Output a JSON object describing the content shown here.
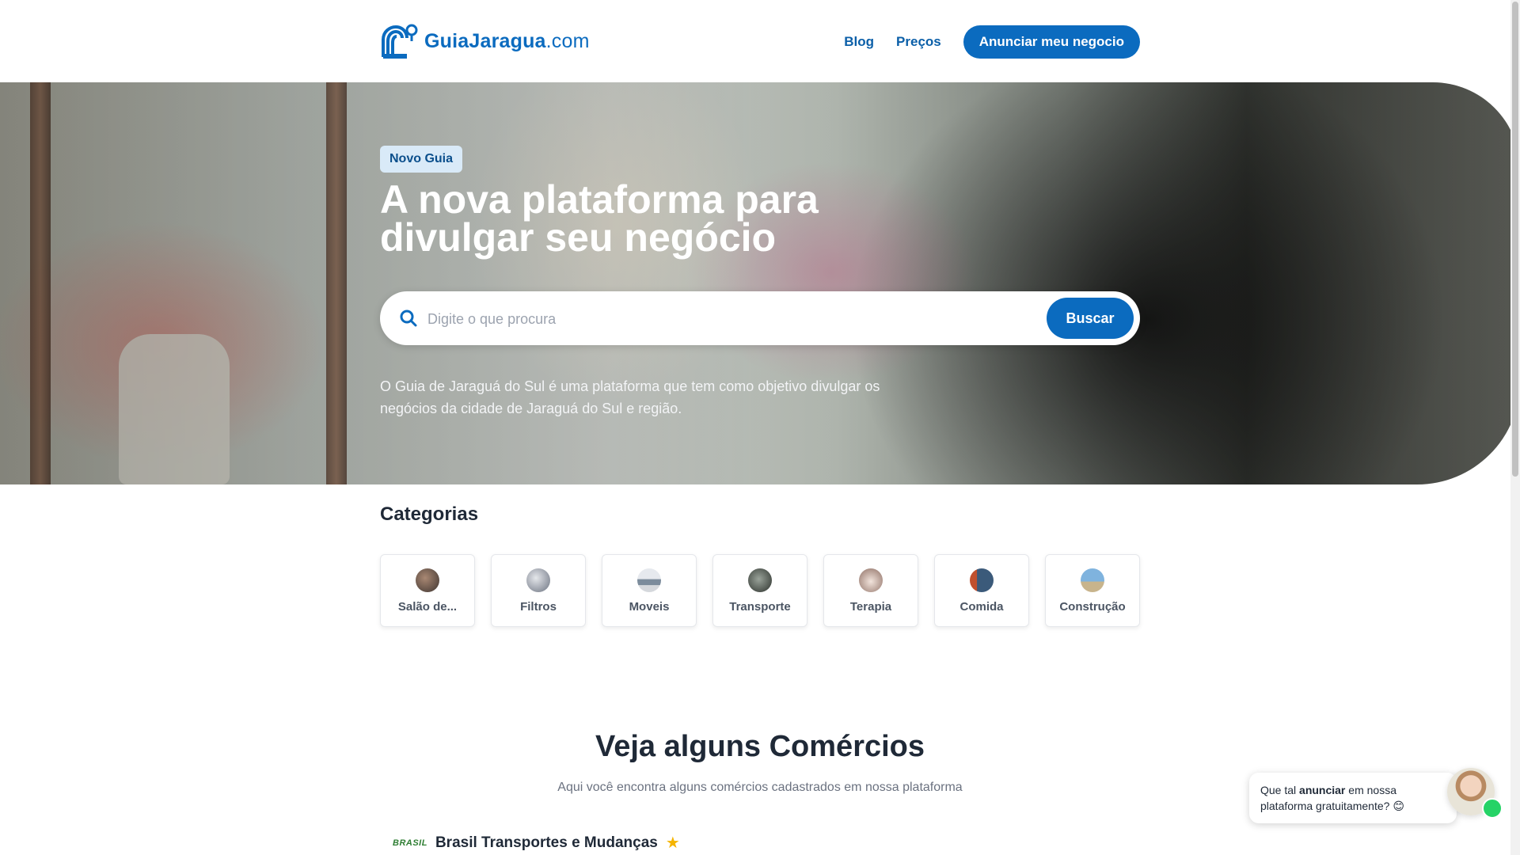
{
  "header": {
    "logo_name": "GuiaJaragua",
    "logo_domain": ".com",
    "nav": {
      "blog": "Blog",
      "precos": "Preços",
      "cta": "Anunciar meu negocio"
    }
  },
  "hero": {
    "badge": "Novo Guia",
    "title_line1": "A nova plataforma para",
    "title_line2": "divulgar seu negócio",
    "search": {
      "placeholder": "Digite o que procura",
      "button": "Buscar"
    },
    "description": "O Guia de Jaraguá do Sul é uma plataforma que tem como objetivo divulgar os negócios da cidade de Jaraguá do Sul e região."
  },
  "categories": {
    "title": "Categorias",
    "items": [
      {
        "label": "Salão de..."
      },
      {
        "label": "Filtros"
      },
      {
        "label": "Moveis"
      },
      {
        "label": "Transporte"
      },
      {
        "label": "Terapia"
      },
      {
        "label": "Comida"
      },
      {
        "label": "Construção"
      }
    ]
  },
  "commerces": {
    "title": "Veja alguns Comércios",
    "subtitle": "Aqui você encontra alguns comércios cadastrados em nossa plataforma",
    "first": {
      "logo_text": "BRASIL",
      "name": "Brasil Transportes e Mudanças"
    }
  },
  "chat": {
    "text_before": "Que tal ",
    "text_bold": "anunciar",
    "text_after": " em nossa plataforma gratuitamente? 😊"
  },
  "colors": {
    "brand": "#0b6bbf",
    "badge_bg": "#d9eaf8",
    "star": "#f5b400",
    "whatsapp": "#25d366"
  }
}
